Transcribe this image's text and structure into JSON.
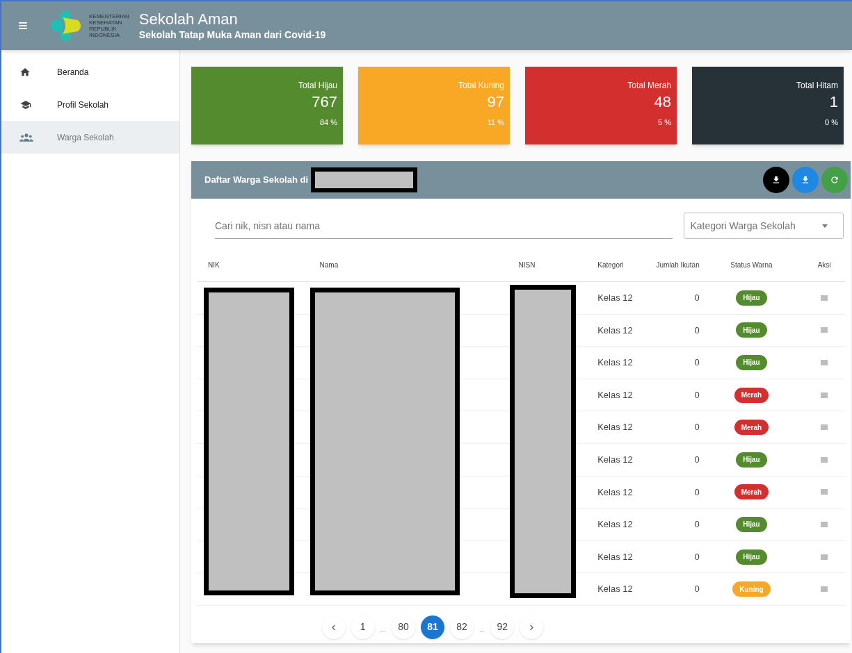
{
  "header": {
    "menu_icon": "≡",
    "logo_text": [
      "KEMENTERIAN",
      "KESEHATAN",
      "REPUBLIK",
      "INDONESIA"
    ],
    "title": "Sekolah Aman",
    "subtitle": "Sekolah Tatap Muka Aman dari Covid-19"
  },
  "sidebar": {
    "items": [
      {
        "label": "Beranda",
        "kind": "home",
        "selected": false
      },
      {
        "label": "Profil Sekolah",
        "kind": "school",
        "selected": false
      },
      {
        "label": "Warga Sekolah",
        "kind": "people",
        "selected": true
      }
    ]
  },
  "stats": [
    {
      "label": "Total Hijau",
      "value": "767",
      "percent": "84 %",
      "color": "#558b2f"
    },
    {
      "label": "Total Kuning",
      "value": "97",
      "percent": "11 %",
      "color": "#f9a825"
    },
    {
      "label": "Total Merah",
      "value": "48",
      "percent": "5 %",
      "color": "#d32f2f"
    },
    {
      "label": "Total Hitam",
      "value": "1",
      "percent": "0 %",
      "color": "#263238"
    }
  ],
  "panel": {
    "title": "Daftar Warga Sekolah di",
    "actions": [
      {
        "kind": "download",
        "color": "#000000"
      },
      {
        "kind": "download",
        "color": "#1e88e5"
      },
      {
        "kind": "refresh",
        "color": "#43a047"
      }
    ],
    "search": {
      "placeholder": "Cari nik, nisn atau nama"
    },
    "filter": {
      "placeholder": "Kategori Warga Sekolah"
    },
    "columns": [
      "NIK",
      "Nama",
      "NISN",
      "Kategori",
      "Jumlah Ikutan",
      "Status Warna",
      "Aksi"
    ],
    "rows": [
      {
        "kategori": "Kelas 12",
        "jumlah": "0",
        "status": "Hijau",
        "color": "#558b2f"
      },
      {
        "kategori": "Kelas 12",
        "jumlah": "0",
        "status": "Hijau",
        "color": "#558b2f"
      },
      {
        "kategori": "Kelas 12",
        "jumlah": "0",
        "status": "Hijau",
        "color": "#558b2f"
      },
      {
        "kategori": "Kelas 12",
        "jumlah": "0",
        "status": "Merah",
        "color": "#d32f2f"
      },
      {
        "kategori": "Kelas 12",
        "jumlah": "0",
        "status": "Merah",
        "color": "#d32f2f"
      },
      {
        "kategori": "Kelas 12",
        "jumlah": "0",
        "status": "Hijau",
        "color": "#558b2f"
      },
      {
        "kategori": "Kelas 12",
        "jumlah": "0",
        "status": "Merah",
        "color": "#d32f2f"
      },
      {
        "kategori": "Kelas 12",
        "jumlah": "0",
        "status": "Hijau",
        "color": "#558b2f"
      },
      {
        "kategori": "Kelas 12",
        "jumlah": "0",
        "status": "Hijau",
        "color": "#558b2f"
      },
      {
        "kategori": "Kelas 12",
        "jumlah": "0",
        "status": "Kuning",
        "color": "#f9a825"
      }
    ],
    "pagination": [
      {
        "kind": "prev",
        "label": "‹"
      },
      {
        "kind": "page",
        "label": "1",
        "selected": false
      },
      {
        "kind": "ellipsis",
        "label": "..."
      },
      {
        "kind": "page",
        "label": "80",
        "selected": false
      },
      {
        "kind": "page",
        "label": "81",
        "selected": true
      },
      {
        "kind": "page",
        "label": "82",
        "selected": false
      },
      {
        "kind": "ellipsis",
        "label": "..."
      },
      {
        "kind": "page",
        "label": "92",
        "selected": false
      },
      {
        "kind": "next",
        "label": "›"
      }
    ]
  }
}
